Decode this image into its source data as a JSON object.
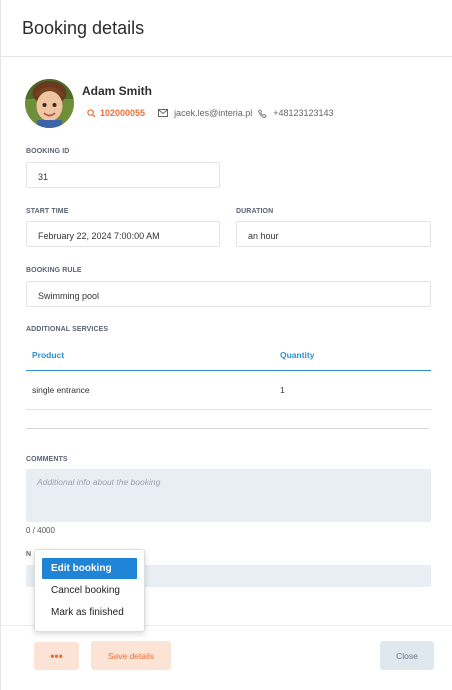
{
  "header": {
    "title": "Booking details"
  },
  "profile": {
    "name": "Adam Smith",
    "customer_id": "102000055",
    "email": "jacek.les@interia.pl",
    "phone": "+48123123143"
  },
  "fields": {
    "booking_id": {
      "label": "BOOKING ID",
      "value": "31"
    },
    "start_time": {
      "label": "START TIME",
      "value": "February 22, 2024 7:00:00 AM"
    },
    "duration": {
      "label": "DURATION",
      "value": "an hour"
    },
    "booking_rule": {
      "label": "BOOKING RULE",
      "value": "Swimming pool"
    }
  },
  "additional_services": {
    "label": "ADDITIONAL SERVICES",
    "columns": [
      "Product",
      "Quantity"
    ],
    "rows": [
      {
        "product": "single entrance",
        "quantity": "1"
      }
    ]
  },
  "comments": {
    "label": "COMMENTS",
    "placeholder": "Additional info about the booking",
    "counter": "0 / 4000"
  },
  "notes": {
    "label_visible": "N"
  },
  "menu": {
    "items": [
      {
        "label": "Edit booking",
        "active": true
      },
      {
        "label": "Cancel booking",
        "active": false
      },
      {
        "label": "Mark as finished",
        "active": false
      }
    ]
  },
  "footer": {
    "more_label": "•••",
    "save_label": "Save details",
    "close_label": "Close"
  },
  "colors": {
    "accent": "#e8703a",
    "primary": "#1f84d5",
    "table_header": "#2f8fcf",
    "input_bg": "#e8eef4"
  }
}
